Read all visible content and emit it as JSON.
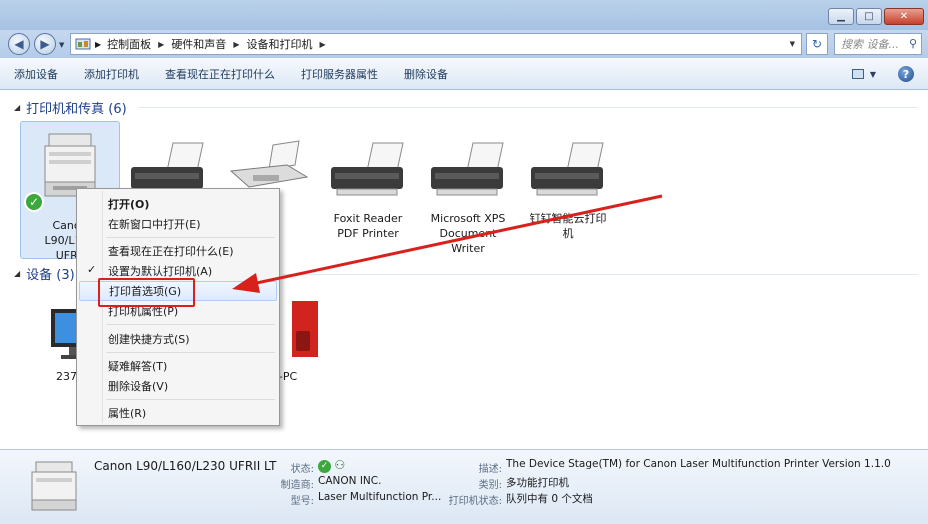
{
  "address": {
    "crumbs": [
      "控制面板",
      "硬件和声音",
      "设备和打印机"
    ],
    "search_placeholder": "搜索 设备..."
  },
  "toolbar": {
    "items": [
      "添加设备",
      "添加打印机",
      "查看现在正在打印什么",
      "打印服务器属性",
      "删除设备"
    ]
  },
  "printers_group": {
    "title": "打印机和传真 (6)",
    "devices": [
      {
        "label_lines": [
          "Canon",
          "L90/L160",
          "UFRII"
        ],
        "icon": "mfp-printer-icon",
        "selected": true,
        "default": true
      },
      {
        "label_lines": [],
        "icon": "printer-icon"
      },
      {
        "label_lines": [],
        "icon": "fax-icon"
      },
      {
        "label_lines": [
          "Foxit Reader",
          "PDF Printer"
        ],
        "icon": "printer-icon"
      },
      {
        "label_lines": [
          "Microsoft XPS",
          "Document",
          "Writer"
        ],
        "icon": "printer-icon"
      },
      {
        "label_lines": [
          "钉钉智能云打印",
          "机"
        ],
        "icon": "printer-icon"
      }
    ]
  },
  "devices_group": {
    "title": "设备 (3)",
    "devices": [
      {
        "label": "2379",
        "icon": "monitor-icon"
      },
      {
        "label": "-PC",
        "icon": "pc-icon"
      }
    ]
  },
  "context_menu": {
    "items": [
      {
        "label": "打开(O)",
        "bold": true
      },
      {
        "label": "在新窗口中打开(E)"
      },
      {
        "label": "查看现在正在打印什么(E)"
      },
      {
        "label": "设置为默认打印机(A)",
        "checked": true
      },
      {
        "label": "打印首选项(G)",
        "hover": true
      },
      {
        "label": "打印机属性(P)"
      },
      {
        "label": "创建快捷方式(S)"
      },
      {
        "label": "疑难解答(T)"
      },
      {
        "label": "删除设备(V)"
      },
      {
        "label": "属性(R)"
      }
    ]
  },
  "details": {
    "title": "Canon L90/L160/L230 UFRII LT",
    "status_label": "状态:",
    "manufacturer_label": "制造商:",
    "manufacturer": "CANON INC.",
    "model_label": "型号:",
    "model": "Laser Multifunction Pr...",
    "desc_label": "描述:",
    "desc": "The Device Stage(TM) for Canon Laser Multifunction Printer Version 1.1.0",
    "category_label": "类别:",
    "category": "多功能打印机",
    "printstatus_label": "打印机状态:",
    "printstatus": "队列中有 0 个文档"
  },
  "colors": {
    "annotation_red": "#d9211c",
    "status_green": "#3aa83c"
  }
}
